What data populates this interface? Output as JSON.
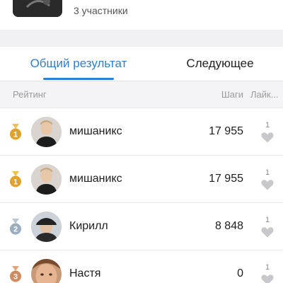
{
  "group": {
    "members_label": "3 участники"
  },
  "tabs": [
    {
      "label": "Общий результат",
      "active": true
    },
    {
      "label": "Следующее",
      "active": false
    }
  ],
  "columns": {
    "rank": "Рейтинг",
    "steps": "Шаги",
    "likes": "Лайк..."
  },
  "rows": [
    {
      "medal": "gold",
      "medal_number": "1",
      "name": "мишаникс",
      "steps": "17 955",
      "likes": "1",
      "avatar": "avatar-young-man-black-hoodie"
    },
    {
      "medal": "gold",
      "medal_number": "1",
      "name": "мишаникс",
      "steps": "17 955",
      "likes": "1",
      "avatar": "avatar-young-man-black-hoodie"
    },
    {
      "medal": "silver",
      "medal_number": "2",
      "name": "Кирилл",
      "steps": "8 848",
      "likes": "1",
      "avatar": "avatar-man-in-cap"
    },
    {
      "medal": "bronze",
      "medal_number": "3",
      "name": "Настя",
      "steps": "0",
      "likes": "1",
      "avatar": "avatar-woman-face"
    }
  ],
  "colors": {
    "accent": "#2d7fd0",
    "gold": "#e2a22a",
    "silver": "#9aaec0",
    "bronze": "#d08a62",
    "heart": "#c8c8cc"
  }
}
